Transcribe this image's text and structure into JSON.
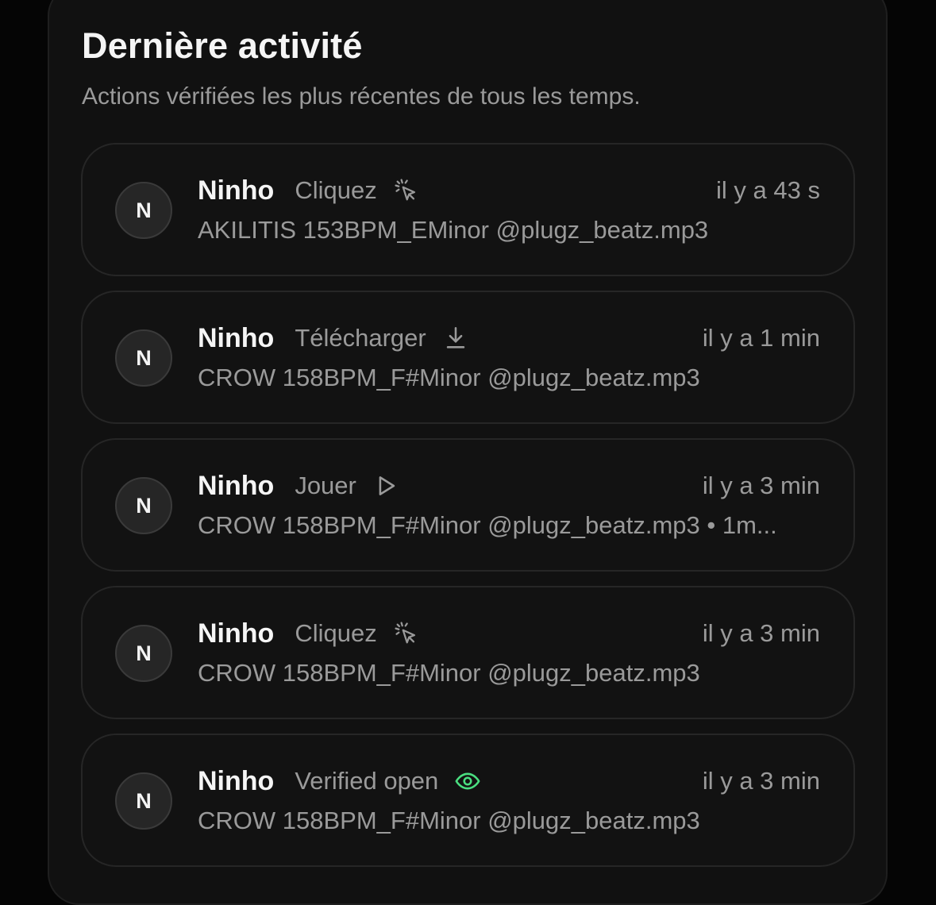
{
  "header": {
    "title": "Dernière activité",
    "subtitle": "Actions vérifiées les plus récentes de tous les temps."
  },
  "activities": [
    {
      "initial": "N",
      "user": "Ninho",
      "action": "Cliquez",
      "icon": "cursor-click-icon",
      "time": "il y a 43 s",
      "detail": "AKILITIS 153BPM_EMinor @plugz_beatz.mp3"
    },
    {
      "initial": "N",
      "user": "Ninho",
      "action": "Télécharger",
      "icon": "download-icon",
      "time": "il y a 1 min",
      "detail": "CROW 158BPM_F#Minor @plugz_beatz.mp3"
    },
    {
      "initial": "N",
      "user": "Ninho",
      "action": "Jouer",
      "icon": "play-icon",
      "time": "il y a 3 min",
      "detail": "CROW 158BPM_F#Minor @plugz_beatz.mp3 • 1m..."
    },
    {
      "initial": "N",
      "user": "Ninho",
      "action": "Cliquez",
      "icon": "cursor-click-icon",
      "time": "il y a 3 min",
      "detail": "CROW 158BPM_F#Minor @plugz_beatz.mp3"
    },
    {
      "initial": "N",
      "user": "Ninho",
      "action": "Verified open",
      "icon": "eye-icon",
      "time": "il y a 3 min",
      "detail": "CROW 158BPM_F#Minor @plugz_beatz.mp3"
    }
  ],
  "colors": {
    "background": "#050505",
    "panel": "#111111",
    "card_border": "#262626",
    "muted_text": "#9a9a9a",
    "accent_green": "#4ade80"
  }
}
